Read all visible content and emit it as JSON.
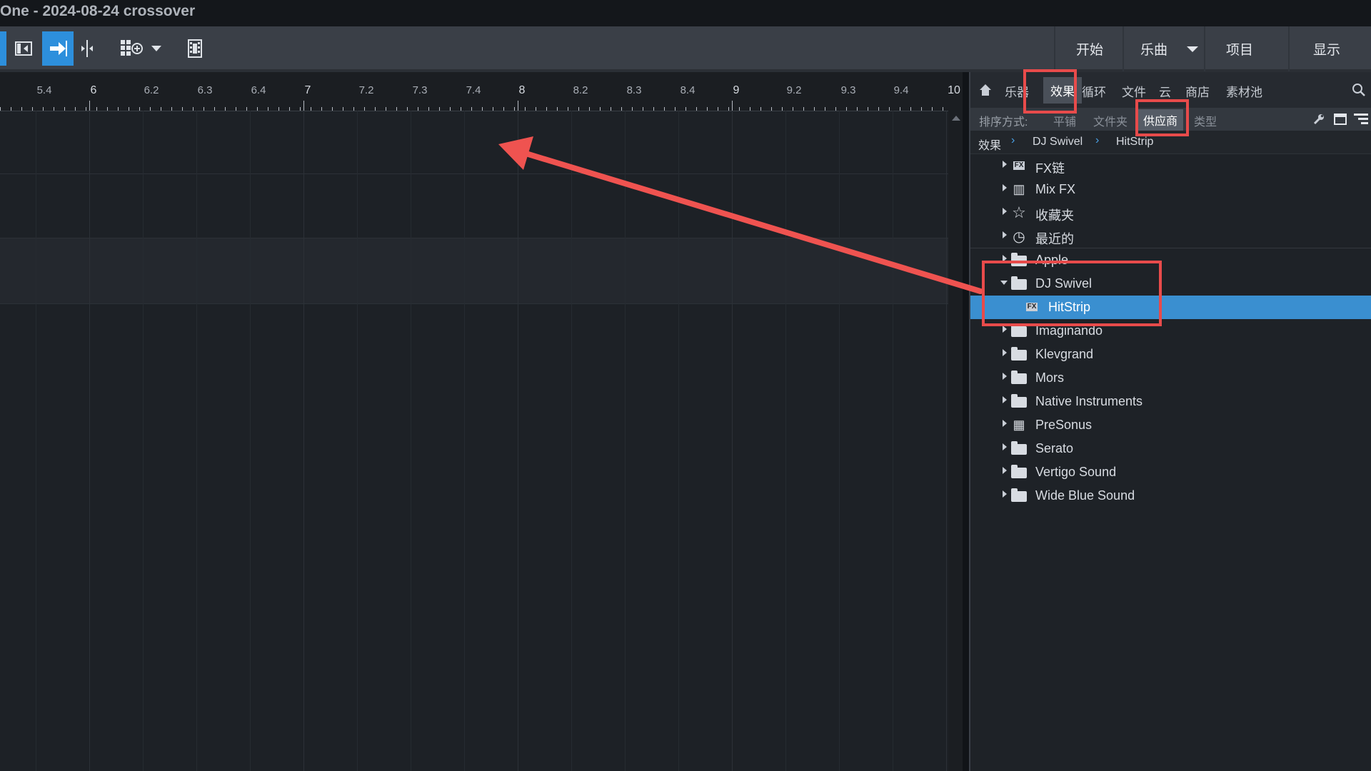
{
  "window": {
    "title": "One - 2024-08-24 crossover"
  },
  "toolbar": {
    "tools": [
      {
        "icon": "edit-split-icon",
        "active": false
      },
      {
        "icon": "snap-arrow-icon",
        "active": true
      },
      {
        "icon": "split-cursor-icon",
        "active": false
      },
      {
        "icon": "grid-add-icon",
        "active": false
      },
      {
        "icon": "video-icon",
        "active": false
      }
    ],
    "nav": {
      "start": "开始",
      "song": "乐曲",
      "project": "项目",
      "show": "显示"
    }
  },
  "ruler": {
    "ticks": [
      {
        "label": "5.4",
        "major": false
      },
      {
        "label": "6",
        "major": true
      },
      {
        "label": "6.2",
        "major": false
      },
      {
        "label": "6.3",
        "major": false
      },
      {
        "label": "6.4",
        "major": false
      },
      {
        "label": "7",
        "major": true
      },
      {
        "label": "7.2",
        "major": false
      },
      {
        "label": "7.3",
        "major": false
      },
      {
        "label": "7.4",
        "major": false
      },
      {
        "label": "8",
        "major": true
      },
      {
        "label": "8.2",
        "major": false
      },
      {
        "label": "8.3",
        "major": false
      },
      {
        "label": "8.4",
        "major": false
      },
      {
        "label": "9",
        "major": true
      },
      {
        "label": "9.2",
        "major": false
      },
      {
        "label": "9.3",
        "major": false
      },
      {
        "label": "9.4",
        "major": false
      },
      {
        "label": "10",
        "major": true
      }
    ]
  },
  "browser": {
    "tabs": {
      "home_icon": "home-icon",
      "instruments": "乐器",
      "effects": "效果",
      "loops": "循环",
      "files": "文件",
      "cloud": "云",
      "shop": "商店",
      "pool": "素材池",
      "search_icon": "search-icon"
    },
    "sort": {
      "label": "排序方式:",
      "flat": "平铺",
      "folder": "文件夹",
      "vendor": "供应商",
      "type": "类型"
    },
    "breadcrumb": [
      "效果",
      "DJ Swivel",
      "HitStrip"
    ],
    "tree": [
      {
        "label": "FX链",
        "icon": "fx-chain-icon",
        "expanded": false,
        "selected": false,
        "child": false
      },
      {
        "label": "Mix FX",
        "icon": "mix-fx-icon",
        "expanded": false,
        "selected": false,
        "child": false
      },
      {
        "label": "收藏夹",
        "icon": "star-icon",
        "expanded": false,
        "selected": false,
        "child": false
      },
      {
        "label": "最近的",
        "icon": "clock-icon",
        "expanded": false,
        "selected": false,
        "child": false
      },
      {
        "label": "Apple",
        "icon": "folder-icon",
        "expanded": false,
        "selected": false,
        "child": false
      },
      {
        "label": "DJ Swivel",
        "icon": "folder-open-icon",
        "expanded": true,
        "selected": false,
        "child": false
      },
      {
        "label": "HitStrip",
        "icon": "fx-au-icon",
        "expanded": false,
        "selected": true,
        "child": true
      },
      {
        "label": "Imaginando",
        "icon": "folder-icon",
        "expanded": false,
        "selected": false,
        "child": false
      },
      {
        "label": "Klevgrand",
        "icon": "folder-icon",
        "expanded": false,
        "selected": false,
        "child": false
      },
      {
        "label": "Mors",
        "icon": "folder-icon",
        "expanded": false,
        "selected": false,
        "child": false
      },
      {
        "label": "Native Instruments",
        "icon": "folder-icon",
        "expanded": false,
        "selected": false,
        "child": false
      },
      {
        "label": "PreSonus",
        "icon": "presonus-icon",
        "expanded": false,
        "selected": false,
        "child": false
      },
      {
        "label": "Serato",
        "icon": "folder-icon",
        "expanded": false,
        "selected": false,
        "child": false
      },
      {
        "label": "Vertigo Sound",
        "icon": "folder-icon",
        "expanded": false,
        "selected": false,
        "child": false
      },
      {
        "label": "Wide Blue Sound",
        "icon": "folder-icon",
        "expanded": false,
        "selected": false,
        "child": false
      }
    ]
  },
  "colors": {
    "accent": "#2d8fdc",
    "selection": "#3a8fd0",
    "annotation": "#e84b4b"
  }
}
